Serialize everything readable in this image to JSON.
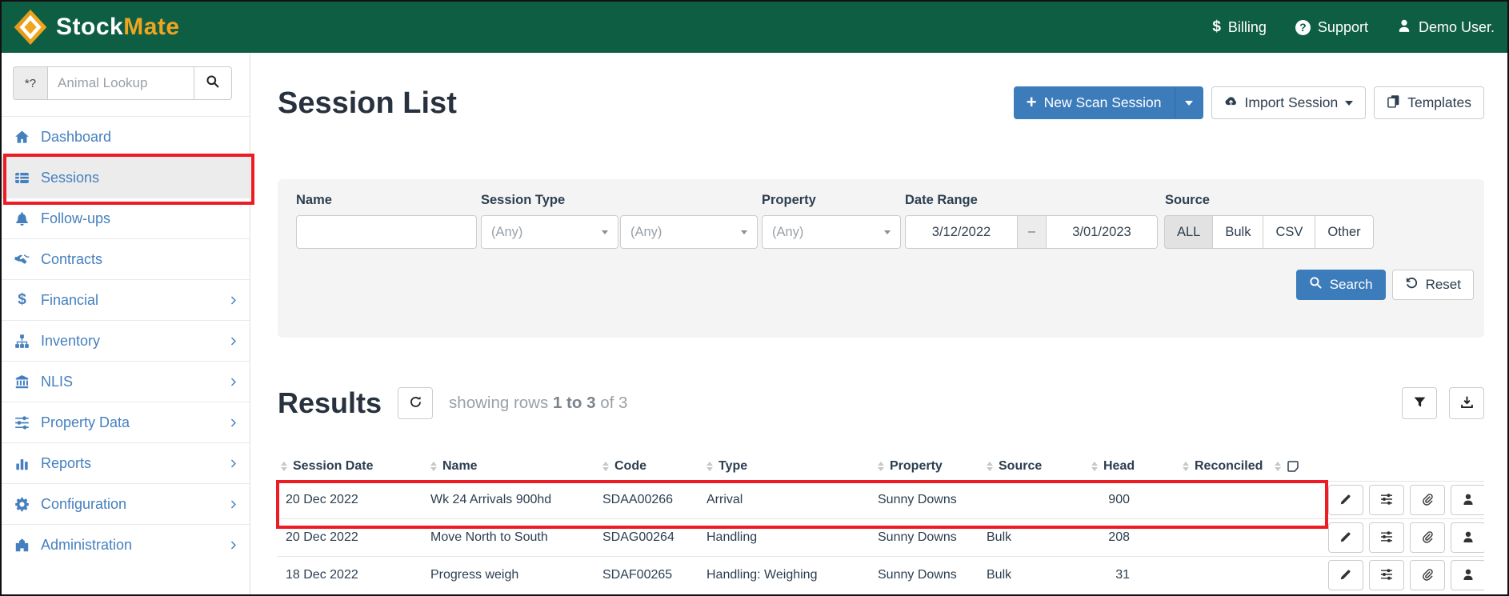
{
  "brand": {
    "stock": "Stock",
    "mate": "Mate"
  },
  "topnav": {
    "billing": "Billing",
    "support": "Support",
    "user": "Demo User."
  },
  "sidebar": {
    "lookup": {
      "addon": "*?",
      "placeholder": "Animal Lookup"
    },
    "items": [
      {
        "label": "Dashboard",
        "icon": "home-icon",
        "active": false,
        "chevron": false
      },
      {
        "label": "Sessions",
        "icon": "table-icon",
        "active": true,
        "chevron": false
      },
      {
        "label": "Follow-ups",
        "icon": "bell-icon",
        "active": false,
        "chevron": false
      },
      {
        "label": "Contracts",
        "icon": "handshake-icon",
        "active": false,
        "chevron": false
      },
      {
        "label": "Financial",
        "icon": "dollar-icon",
        "active": false,
        "chevron": true
      },
      {
        "label": "Inventory",
        "icon": "sitemap-icon",
        "active": false,
        "chevron": true
      },
      {
        "label": "NLIS",
        "icon": "bank-icon",
        "active": false,
        "chevron": true
      },
      {
        "label": "Property Data",
        "icon": "sliders-icon",
        "active": false,
        "chevron": true
      },
      {
        "label": "Reports",
        "icon": "bar-chart-icon",
        "active": false,
        "chevron": true
      },
      {
        "label": "Configuration",
        "icon": "gear-icon",
        "active": false,
        "chevron": true
      },
      {
        "label": "Administration",
        "icon": "building-icon",
        "active": false,
        "chevron": true
      }
    ]
  },
  "page": {
    "title": "Session List"
  },
  "toolbar": {
    "new_scan_label": "New Scan Session",
    "import_label": "Import Session",
    "templates_label": "Templates"
  },
  "filters": {
    "name_label": "Name",
    "session_type_label": "Session Type",
    "property_label": "Property",
    "date_range_label": "Date Range",
    "source_label": "Source",
    "session_type_value": "(Any)",
    "session_subtype_value": "(Any)",
    "property_value": "(Any)",
    "date_from": "3/12/2022",
    "date_separator": "–",
    "date_to": "3/01/2023",
    "source_options": [
      "ALL",
      "Bulk",
      "CSV",
      "Other"
    ],
    "source_active": "ALL",
    "search_label": "Search",
    "reset_label": "Reset"
  },
  "results": {
    "title": "Results",
    "showing_prefix": "showing rows",
    "showing_range": "1 to 3",
    "showing_suffix": "of 3"
  },
  "table": {
    "headers": [
      "Session Date",
      "Name",
      "Code",
      "Type",
      "Property",
      "Source",
      "Head",
      "Reconciled"
    ],
    "rows": [
      {
        "session_date": "20 Dec 2022",
        "name": "Wk 24 Arrivals 900hd",
        "code": "SDAA00266",
        "type": "Arrival",
        "property": "Sunny Downs",
        "source": "",
        "head": "900",
        "reconciled": "",
        "highlighted": true
      },
      {
        "session_date": "20 Dec 2022",
        "name": "Move North to South",
        "code": "SDAG00264",
        "type": "Handling",
        "property": "Sunny Downs",
        "source": "Bulk",
        "head": "208",
        "reconciled": "",
        "highlighted": false
      },
      {
        "session_date": "18 Dec 2022",
        "name": "Progress weigh",
        "code": "SDAF00265",
        "type": "Handling: Weighing",
        "property": "Sunny Downs",
        "source": "Bulk",
        "head": "31",
        "reconciled": "",
        "highlighted": false
      }
    ],
    "row_action_icons": [
      "pencil-icon",
      "sliders-icon",
      "paperclip-icon",
      "person-icon"
    ],
    "extra_header_icon": "note-icon"
  },
  "icons": {
    "topnav": [
      "dollar-icon",
      "question-circle-icon",
      "person-icon"
    ],
    "lookup": [
      "search-icon"
    ],
    "toolbar": [
      "plus-icon",
      "caret-down-icon",
      "cloud-upload-icon",
      "copy-icon"
    ],
    "results": [
      "refresh-icon",
      "filter-funnel-icon",
      "download-icon"
    ]
  },
  "colors": {
    "header_green": "#0E5E44",
    "brand_gold": "#EFA51E",
    "link_blue": "#4580BE",
    "primary_button_blue": "#3D7CBB",
    "panel_gray": "#F4F4F4",
    "annotation_red": "#ED1C24"
  }
}
